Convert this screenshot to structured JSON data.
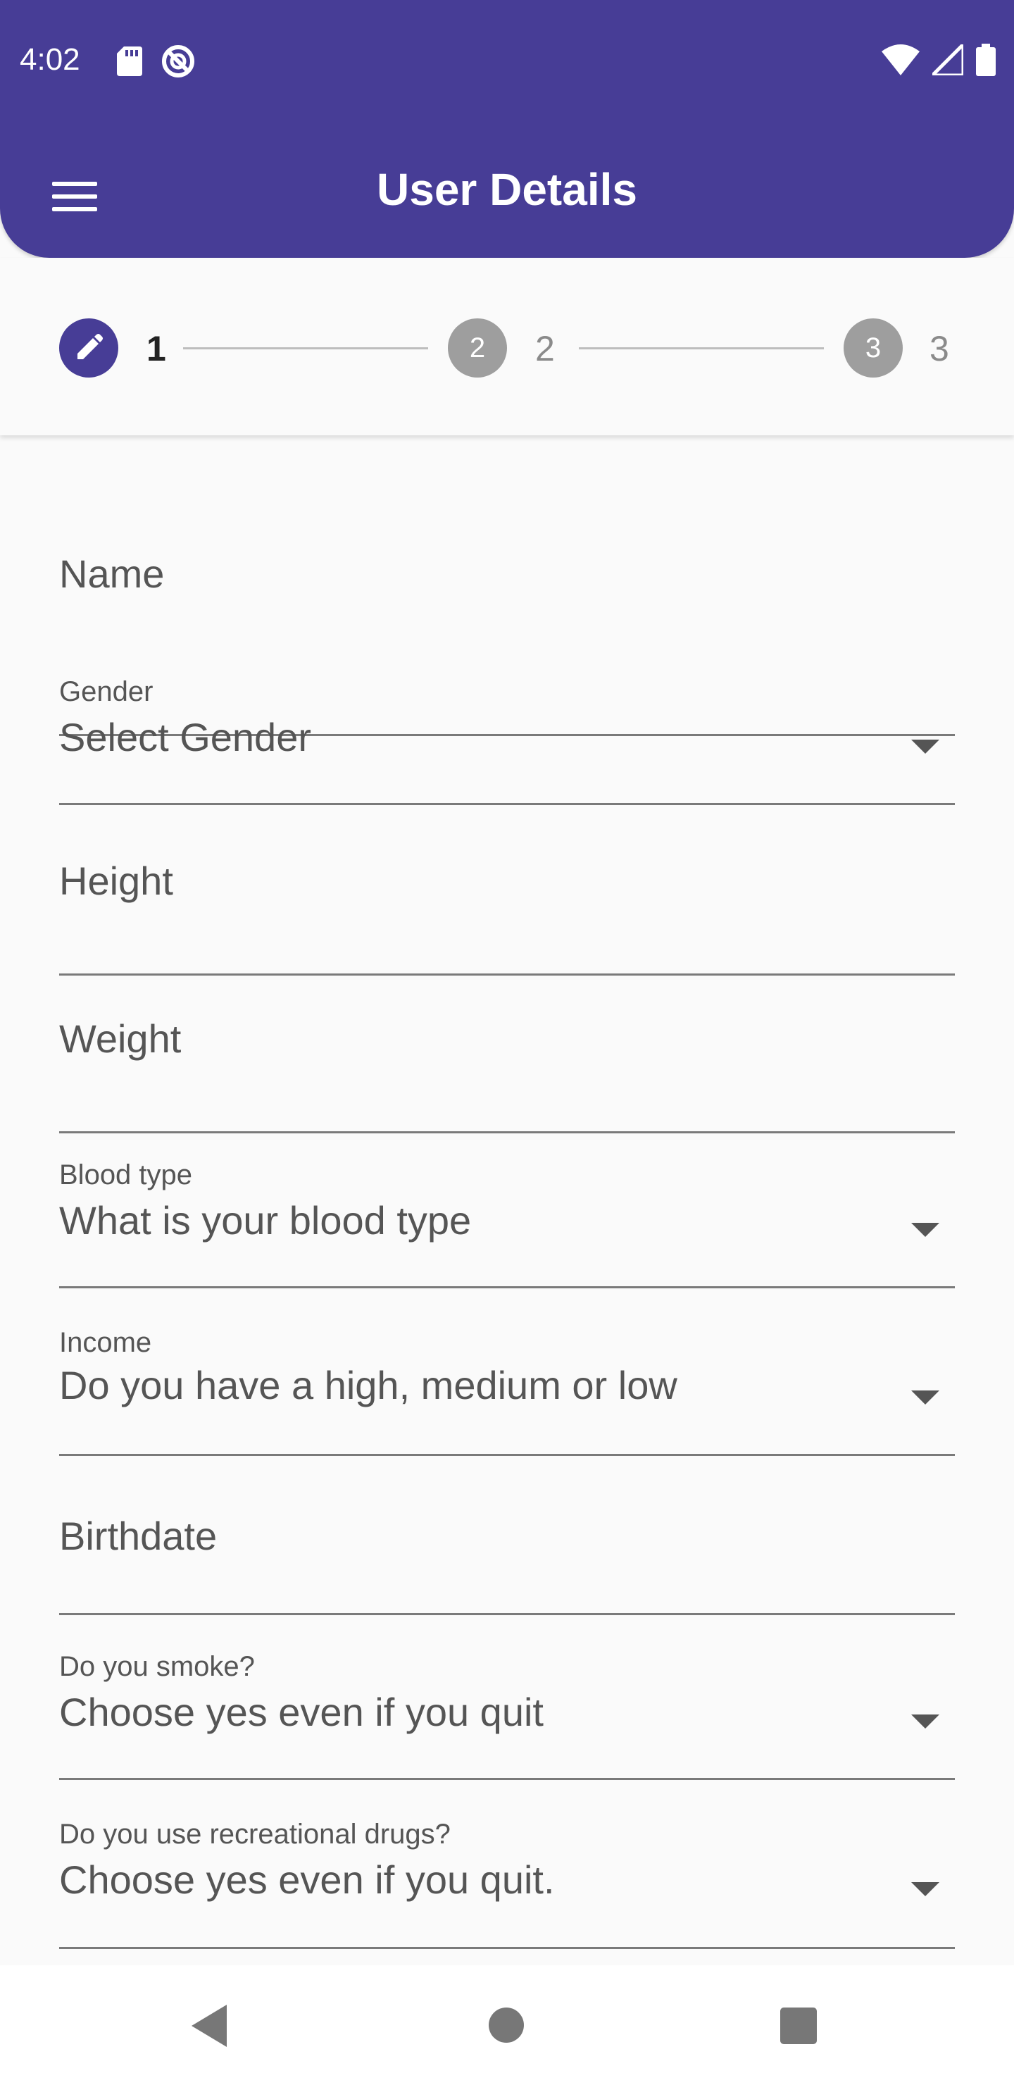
{
  "status_bar": {
    "time": "4:02",
    "left_icons": [
      "sd-card-icon",
      "do-not-disturb-icon"
    ],
    "right_icons": [
      "wifi-icon",
      "signal-icon",
      "battery-icon"
    ]
  },
  "header": {
    "title": "User Details",
    "menu_icon": "menu-icon",
    "color": "#473d96"
  },
  "stepper": {
    "steps": [
      {
        "number": "1",
        "label": "1",
        "state": "active",
        "icon": "pencil-icon",
        "color": "#473d96"
      },
      {
        "number": "2",
        "label": "2",
        "state": "inactive",
        "color": "#9e9e9e"
      },
      {
        "number": "3",
        "label": "3",
        "state": "inactive",
        "color": "#9e9e9e"
      }
    ]
  },
  "form": {
    "name": {
      "placeholder": "Name"
    },
    "gender": {
      "label": "Gender",
      "value": "Select Gender"
    },
    "height": {
      "placeholder": "Height"
    },
    "weight": {
      "placeholder": "Weight"
    },
    "blood_type": {
      "label": "Blood type",
      "value": "What is your blood type"
    },
    "income": {
      "label": "Income",
      "value": "Do you have a high, medium or low"
    },
    "birthdate": {
      "placeholder": "Birthdate"
    },
    "smoke": {
      "label": "Do you smoke?",
      "value": "Choose yes even if you quit"
    },
    "drugs": {
      "label": "Do you use recreational drugs?",
      "value": "Choose yes even if you quit."
    }
  },
  "nav_bar": {
    "icons": [
      "back-icon",
      "home-icon",
      "recents-icon"
    ]
  }
}
